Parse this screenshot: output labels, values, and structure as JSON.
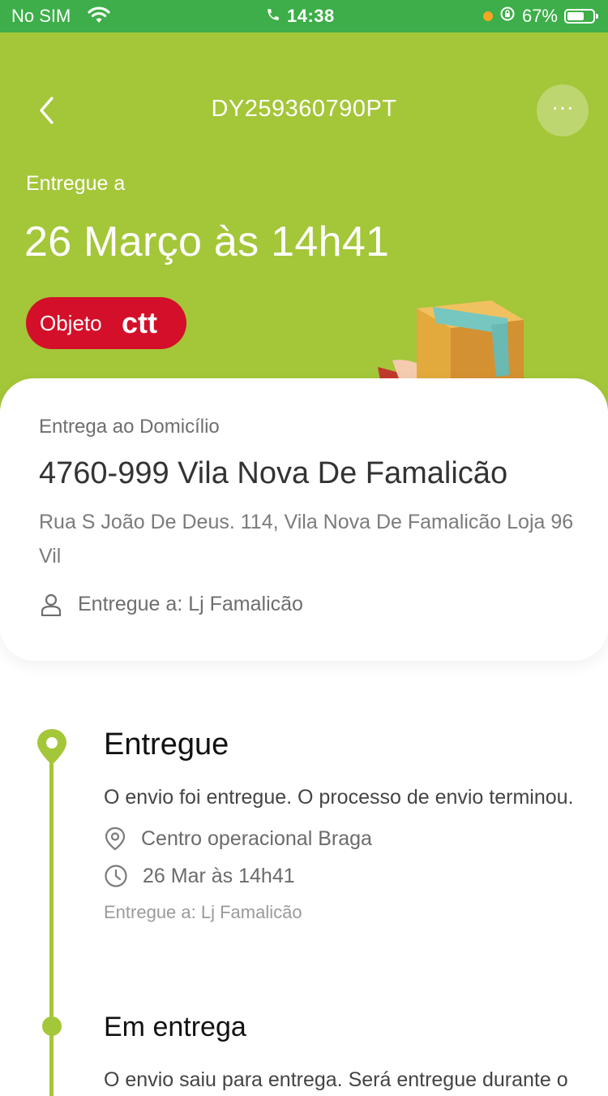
{
  "status_bar": {
    "carrier": "No SIM",
    "time": "14:38",
    "battery": "67%",
    "battery_level": 0.67
  },
  "header": {
    "tracking_code": "DY259360790PT",
    "delivered_label": "Entregue a",
    "delivered_date": "26 Março às  14h41",
    "object_label": "Objeto",
    "brand_logo_text": "ctt",
    "more_icon": "ellipsis-icon",
    "back_icon": "chevron-left-icon"
  },
  "address_card": {
    "type": "Entrega ao Domicílio",
    "city": "4760-999 Vila Nova De Famalicão",
    "street": "Rua S João De Deus. 114, Vila Nova De Famalicão  Loja 96 Vil",
    "recipient": "Entregue a: Lj Famalicão"
  },
  "timeline": [
    {
      "title": "Entregue",
      "description": "O envio foi entregue. O processo de envio terminou.",
      "location": "Centro operacional Braga",
      "datetime": "26 Mar às  14h41",
      "note": "Entregue a: Lj Famalicão"
    },
    {
      "title": "Em entrega",
      "description": "O envio saiu para entrega. Será entregue durante o"
    }
  ],
  "colors": {
    "status_bar": "#3dae49",
    "header_green": "#a4c639",
    "ctt_red": "#d40f2a"
  }
}
